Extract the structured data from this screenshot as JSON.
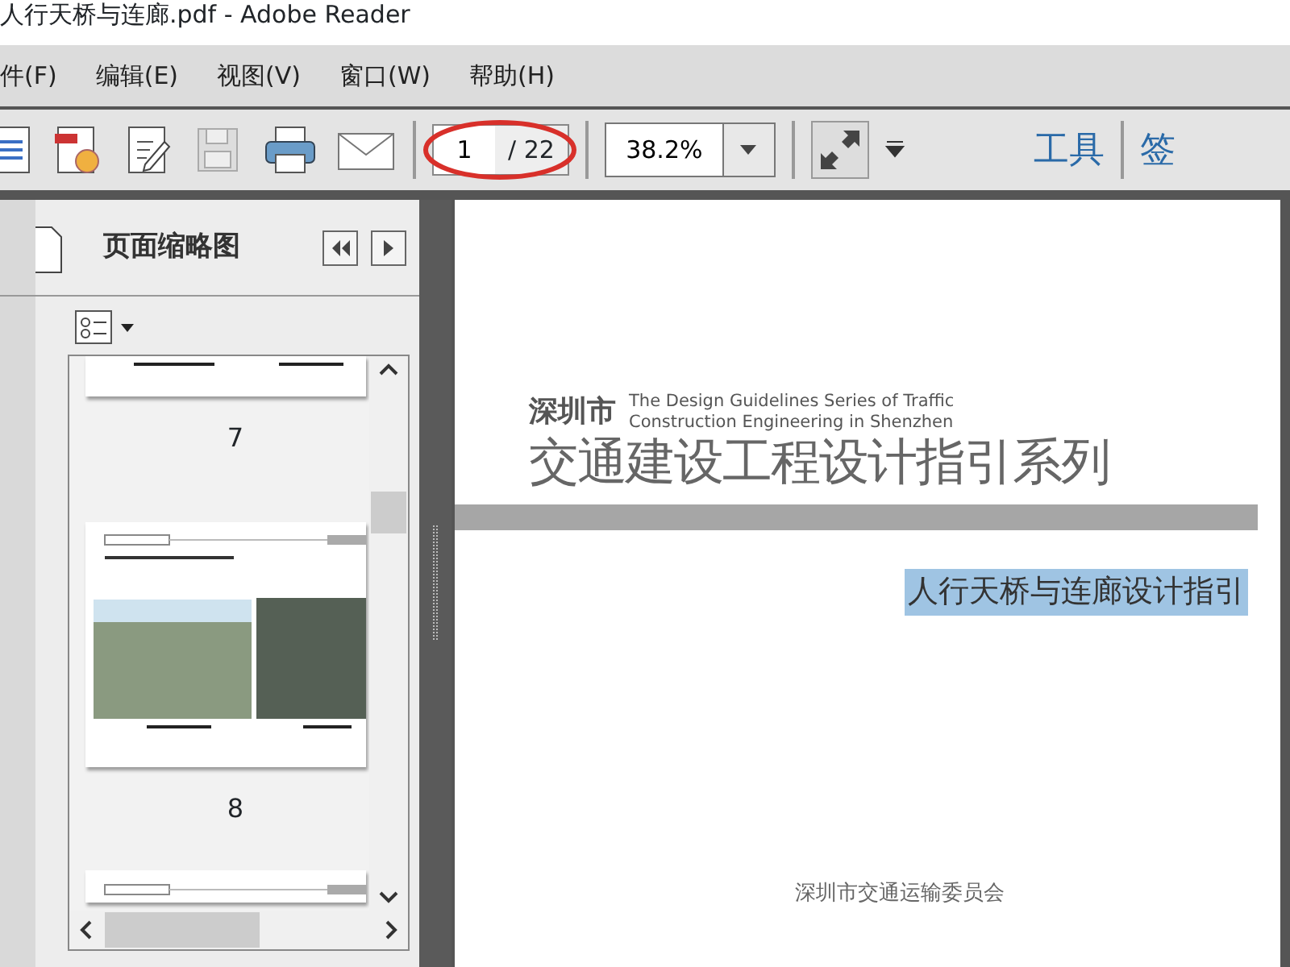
{
  "window": {
    "title": "人行天桥与连廊.pdf - Adobe Reader"
  },
  "menu": [
    "件(F)",
    "编辑(E)",
    "视图(V)",
    "窗口(W)",
    "帮助(H)"
  ],
  "toolbar": {
    "page_number": "1",
    "page_total": "/ 22",
    "zoom": "38.2%",
    "tools": "工具",
    "cut_label": "签"
  },
  "panel": {
    "title": "页面缩略图",
    "thumbnails": [
      {
        "label": "7",
        "kind": "partial"
      },
      {
        "label": "8",
        "kind": "photos"
      },
      {
        "kind": "top"
      }
    ]
  },
  "document": {
    "city": "深圳市",
    "english_lines": [
      "The Design Guidelines Series of Traffic",
      "Construction Engineering in Shenzhen"
    ],
    "series_title": "交通建设工程设计指引系列",
    "subtitle": {
      "text": "人行天桥与连廊设计指引",
      "highlighted": true
    },
    "publisher": "深圳市交通运输委员会"
  }
}
